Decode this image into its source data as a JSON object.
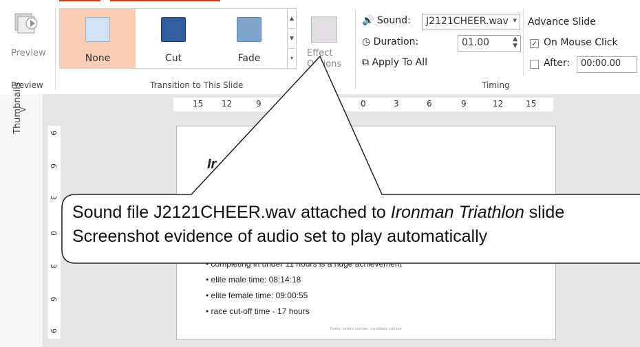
{
  "ribbon": {
    "preview_group": {
      "button_label": "Preview",
      "group_label": "Preview"
    },
    "transition_group": {
      "group_label": "Transition to This Slide",
      "options": [
        {
          "label": "None",
          "selected": true,
          "icon": "none-transition-icon"
        },
        {
          "label": "Cut",
          "selected": false,
          "icon": "cut-transition-icon"
        },
        {
          "label": "Fade",
          "selected": false,
          "icon": "fade-transition-icon"
        }
      ],
      "effect_options_label_line1": "Effect",
      "effect_options_label_line2": "Options"
    },
    "timing_group": {
      "group_label": "Timing",
      "sound_label": "Sound:",
      "sound_value": "J2121CHEER.wav",
      "duration_label": "Duration:",
      "duration_value": "01.00",
      "apply_to_all_label": "Apply To All",
      "advance_slide_label": "Advance Slide",
      "on_mouse_click_label": "On Mouse Click",
      "on_mouse_click_checked": true,
      "after_label": "After:",
      "after_value": "00:00.00",
      "after_checked": false
    }
  },
  "left_panel": {
    "expand_label": ">",
    "thumbnails_label": "Thumbnails"
  },
  "rulers": {
    "horizontal": [
      "15",
      "12",
      "9",
      "0",
      "3",
      "6",
      "9",
      "12",
      "15"
    ],
    "vertical": [
      "9",
      "6",
      "3",
      "0",
      "3",
      "6",
      "9"
    ]
  },
  "slide": {
    "title_fragment": "Ir",
    "bullets": [
      "completing in under 11 hours is a huge achievement",
      "elite male time: 08:14:18",
      "elite female time: 09:00:55",
      "race cut-off time - 17 hours"
    ],
    "footer": "Name, centre number, candidate number"
  },
  "callout": {
    "line1_before": "Sound file J2121CHEER.wav attached to ",
    "line1_italic": "Ironman Triathlon",
    "line1_after": " slide",
    "line2": "Screenshot evidence of audio set to play automatically"
  },
  "colors": {
    "accent": "#c43e1c",
    "selected_tile": "#f7cdb5"
  }
}
